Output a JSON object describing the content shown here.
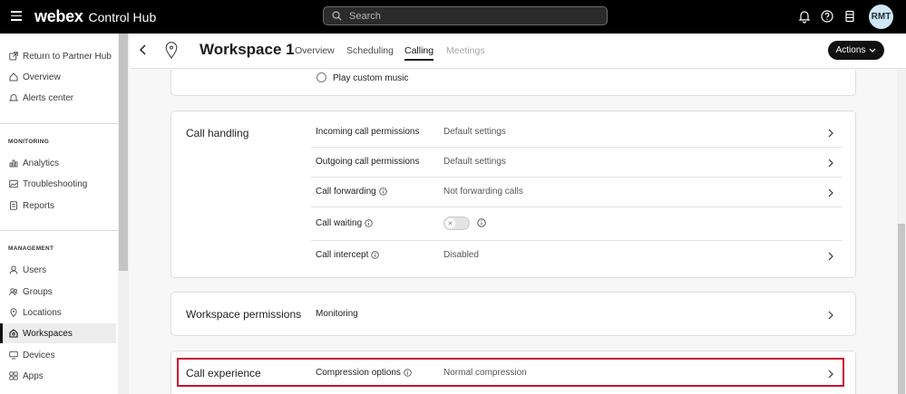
{
  "topbar": {
    "brand": "webex",
    "product": "Control Hub",
    "search_placeholder": "Search",
    "avatar_initials": "RMT"
  },
  "sidebar": {
    "top_items": [
      {
        "label": "Return to Partner Hub",
        "icon": "external-link-icon"
      },
      {
        "label": "Overview",
        "icon": "home-icon"
      },
      {
        "label": "Alerts center",
        "icon": "bell-icon"
      }
    ],
    "monitoring_title": "MONITORING",
    "monitoring_items": [
      {
        "label": "Analytics",
        "icon": "bar-chart-icon"
      },
      {
        "label": "Troubleshooting",
        "icon": "image-icon"
      },
      {
        "label": "Reports",
        "icon": "document-icon"
      }
    ],
    "management_title": "MANAGEMENT",
    "management_items": [
      {
        "label": "Users",
        "icon": "user-icon"
      },
      {
        "label": "Groups",
        "icon": "group-icon"
      },
      {
        "label": "Locations",
        "icon": "location-icon"
      },
      {
        "label": "Workspaces",
        "icon": "workspace-icon",
        "active": true
      },
      {
        "label": "Devices",
        "icon": "device-icon"
      },
      {
        "label": "Apps",
        "icon": "apps-icon"
      }
    ]
  },
  "header": {
    "title": "Workspace 1",
    "tabs": [
      {
        "label": "Overview"
      },
      {
        "label": "Scheduling"
      },
      {
        "label": "Calling",
        "active": true
      },
      {
        "label": "Meetings",
        "disabled": true
      }
    ],
    "actions_label": "Actions"
  },
  "music_card": {
    "option_label": "Play custom music"
  },
  "call_handling": {
    "title": "Call handling",
    "rows": [
      {
        "label": "Incoming call permissions",
        "value": "Default settings",
        "info": false
      },
      {
        "label": "Outgoing call permissions",
        "value": "Default settings",
        "info": false
      },
      {
        "label": "Call forwarding",
        "value": "Not forwarding calls",
        "info": true
      },
      {
        "label": "Call waiting",
        "value": "",
        "info": true,
        "toggle": false
      },
      {
        "label": "Call intercept",
        "value": "Disabled",
        "info": true
      }
    ]
  },
  "workspace_permissions": {
    "title": "Workspace permissions",
    "row": {
      "label": "Monitoring",
      "value": ""
    }
  },
  "call_experience": {
    "title": "Call experience",
    "row": {
      "label": "Compression options",
      "value": "Normal compression",
      "info": true
    }
  },
  "colors": {
    "highlight": "#c8102e",
    "topbar": "#000000"
  }
}
